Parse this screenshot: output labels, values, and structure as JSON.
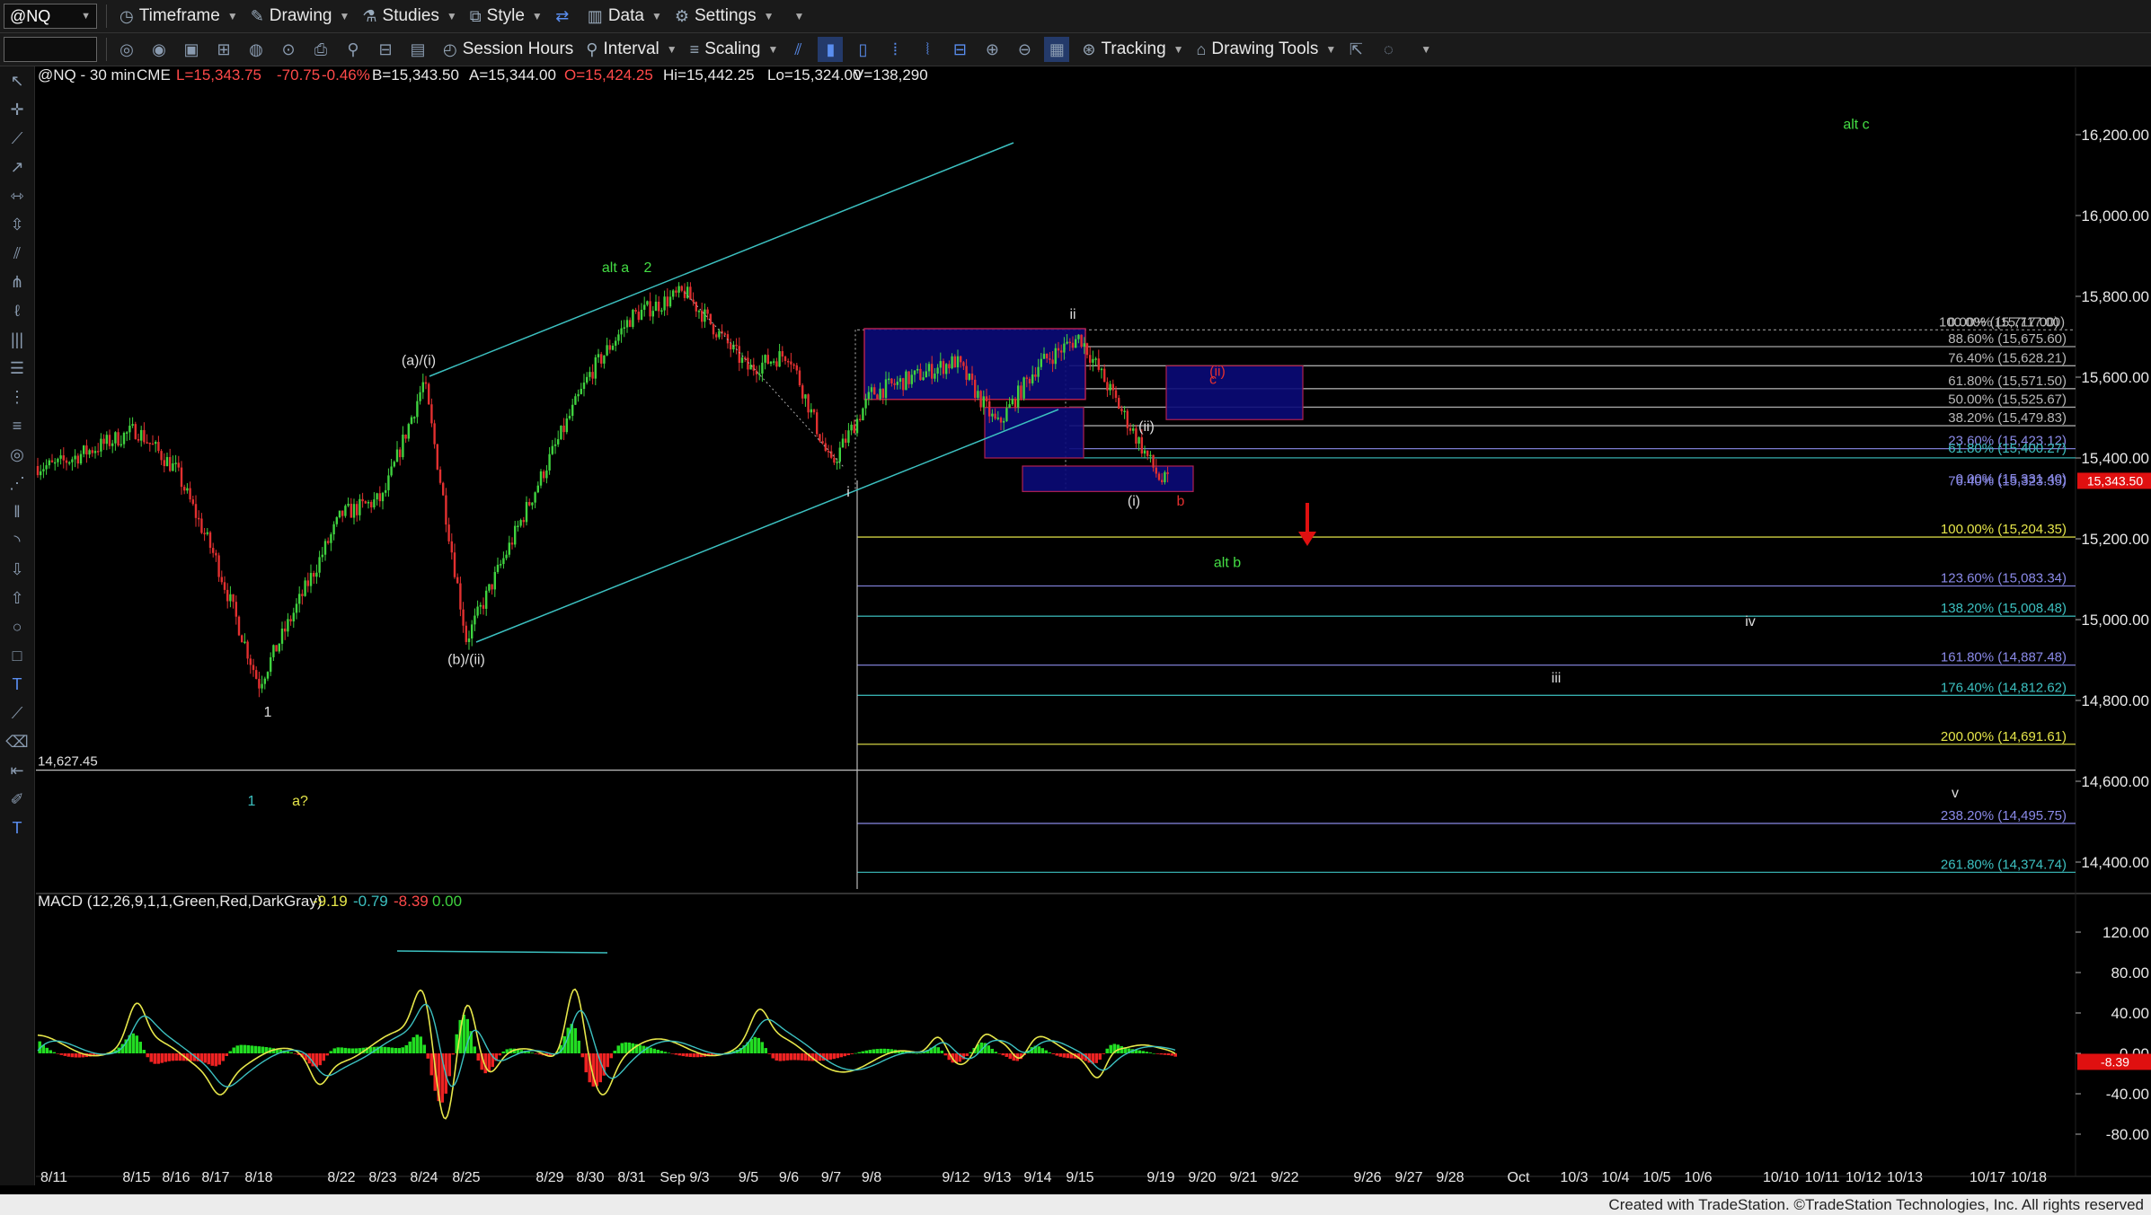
{
  "toolbar": {
    "symbol": "@NQ",
    "timeframe": "Timeframe",
    "drawing": "Drawing",
    "studies": "Studies",
    "style": "Style",
    "data": "Data",
    "settings": "Settings",
    "session_hours": "Session Hours",
    "interval": "Interval",
    "scaling": "Scaling",
    "tracking": "Tracking",
    "drawing_tools": "Drawing Tools"
  },
  "header": {
    "title": "@NQ - 30 min",
    "exchange": "CME",
    "last": "L=15,343.75",
    "change": "-70.75",
    "pct": "-0.46%",
    "bid": "B=15,343.50",
    "ask": "A=15,344.00",
    "open": "O=15,424.25",
    "high": "Hi=15,442.25",
    "low": "Lo=15,324.00",
    "volume": "V=138,290"
  },
  "macd": {
    "label": "MACD (12,26,9,1,1,Green,Red,DarkGray)",
    "v1": "-9.19",
    "v2": "-0.79",
    "v3": "-8.39",
    "v4": "0.00",
    "last_tag": "-8.39"
  },
  "footer": "Created with TradeStation. ©TradeStation Technologies, Inc. All rights reserved",
  "colors": {
    "up": "#3fd23f",
    "down": "#e23030",
    "channel": "#3cc0c0",
    "fib_yellow": "#e6e64a",
    "fib_blue": "#8a8ae8",
    "fib_gray": "#b8b8b8",
    "box_fill": "#0a0a78",
    "box_border": "#b02050",
    "green_label": "#44dd44"
  },
  "chart_data": {
    "type": "candlestick",
    "symbol": "@NQ",
    "interval": "30 min",
    "ylim": [
      14340,
      16300
    ],
    "y_ticks": [
      "16,200.00",
      "16,000.00",
      "15,800.00",
      "15,600.00",
      "15,400.00",
      "15,200.00",
      "15,000.00",
      "14,800.00",
      "14,600.00",
      "14,400.00"
    ],
    "y_tick_values": [
      16200,
      16000,
      15800,
      15600,
      15400,
      15200,
      15000,
      14800,
      14600,
      14400
    ],
    "last_price_tag": "15,343.50",
    "x_ticks": [
      "8/11",
      "8/15",
      "8/16",
      "8/17",
      "8/18",
      "8/22",
      "8/23",
      "8/24",
      "8/25",
      "8/29",
      "8/30",
      "8/31",
      "Sep 9/3",
      "9/5",
      "9/6",
      "9/7",
      "9/8",
      "9/12",
      "9/13",
      "9/14",
      "9/15",
      "9/19",
      "9/20",
      "9/21",
      "9/22",
      "9/26",
      "9/27",
      "9/28",
      "Oct",
      "10/3",
      "10/4",
      "10/5",
      "10/6",
      "10/10",
      "10/11",
      "10/12",
      "10/13",
      "10/17",
      "10/18"
    ],
    "price_path_dates": [
      "8/11",
      "8/15",
      "8/16",
      "8/17",
      "8/18",
      "8/22",
      "8/23",
      "8/24",
      "8/25",
      "8/29",
      "8/30",
      "8/31",
      "Sep 9/3",
      "9/5",
      "9/6",
      "9/7",
      "9/8",
      "9/12",
      "9/13",
      "9/14",
      "9/15",
      "9/19"
    ],
    "price_path_values": [
      15380,
      15470,
      15370,
      15150,
      14840,
      15260,
      15300,
      15590,
      14950,
      15400,
      15610,
      15750,
      15810,
      15620,
      15660,
      15380,
      15560,
      15640,
      15480,
      15630,
      15700,
      15343
    ],
    "fib_levels": [
      {
        "label": "100.00% (15,717.00)",
        "price": 15717.0,
        "color": "#b8b8b8"
      },
      {
        "label": "0.00% (15,717.00)",
        "price": 15717.0,
        "color": "#b8b8b8"
      },
      {
        "label": "88.60% (15,675.60)",
        "price": 15675.6,
        "color": "#b8b8b8"
      },
      {
        "label": "76.40% (15,628.21)",
        "price": 15628.21,
        "color": "#b8b8b8"
      },
      {
        "label": "61.80% (15,571.50)",
        "price": 15571.5,
        "color": "#b8b8b8"
      },
      {
        "label": "50.00% (15,525.67)",
        "price": 15525.67,
        "color": "#b8b8b8"
      },
      {
        "label": "38.20% (15,479.83)",
        "price": 15479.83,
        "color": "#b8b8b8"
      },
      {
        "label": "23.60% (15,423.12)",
        "price": 15423.12,
        "color": "#8a8ae8"
      },
      {
        "label": "61.80% (15,400.27)",
        "price": 15400.27,
        "color": "#3cc0c0"
      },
      {
        "label": "0.00% (15,331.40)",
        "price": 15331.4,
        "color": "#8a8ae8"
      },
      {
        "label": "76.40% (15,323.35)",
        "price": 15323.35,
        "color": "#8a8ae8"
      },
      {
        "label": "100.00% (15,204.35)",
        "price": 15204.35,
        "color": "#e6e64a"
      },
      {
        "label": "123.60% (15,083.34)",
        "price": 15083.34,
        "color": "#8a8ae8"
      },
      {
        "label": "138.20% (15,008.48)",
        "price": 15008.48,
        "color": "#3cc0c0"
      },
      {
        "label": "161.80% (14,887.48)",
        "price": 14887.48,
        "color": "#8a8ae8"
      },
      {
        "label": "176.40% (14,812.62)",
        "price": 14812.62,
        "color": "#3cc0c0"
      },
      {
        "label": "200.00% (14,691.61)",
        "price": 14691.61,
        "color": "#e6e64a"
      },
      {
        "label": "238.20% (14,495.75)",
        "price": 14495.75,
        "color": "#8a8ae8"
      },
      {
        "label": "261.80% (14,374.74)",
        "price": 14374.74,
        "color": "#3cc0c0"
      }
    ],
    "horizontal_line": {
      "label": "14,627.45",
      "price": 14627.45
    },
    "annotations": [
      {
        "text": "alt c",
        "date": "10/11",
        "price": 16215,
        "color": "#44dd44"
      },
      {
        "text": "alt a",
        "date": "8/31",
        "price": 15860,
        "color": "#44dd44"
      },
      {
        "text": "2",
        "date": "8/31",
        "price": 15860,
        "color": "#44dd44"
      },
      {
        "text": "(a)/(i)",
        "date": "8/24",
        "price": 15630,
        "color": "#dddddd"
      },
      {
        "text": "(b)/(ii)",
        "date": "8/25",
        "price": 14890,
        "color": "#dddddd"
      },
      {
        "text": "1",
        "date": "8/18",
        "price": 14760,
        "color": "#dddddd"
      },
      {
        "text": "1",
        "date": "8/17",
        "price": 14540,
        "color": "#3cc0c0"
      },
      {
        "text": "a?",
        "date": "8/18",
        "price": 14540,
        "color": "#e6e64a"
      },
      {
        "text": "ii",
        "date": "9/15",
        "price": 15745,
        "color": "#dddddd"
      },
      {
        "text": "(ii)",
        "date": "9/19",
        "price": 15467,
        "color": "#dddddd"
      },
      {
        "text": "(i)",
        "date": "9/19",
        "price": 15282,
        "color": "#dddddd"
      },
      {
        "text": "(ii)",
        "date": "9/20",
        "price": 15603,
        "color": "#e23030"
      },
      {
        "text": "c",
        "date": "9/20",
        "price": 15583,
        "color": "#e23030"
      },
      {
        "text": "b",
        "date": "9/19",
        "price": 15282,
        "color": "#e23030"
      },
      {
        "text": "i",
        "date": "9/7",
        "price": 15305,
        "color": "#dddddd"
      },
      {
        "text": "alt b",
        "date": "9/21",
        "price": 15130,
        "color": "#44dd44"
      },
      {
        "text": "iv",
        "date": "10/6",
        "price": 14985,
        "color": "#dddddd"
      },
      {
        "text": "iii",
        "date": "10/3",
        "price": 14845,
        "color": "#dddddd"
      },
      {
        "text": "v",
        "date": "10/13",
        "price": 14560,
        "color": "#dddddd"
      }
    ],
    "macd_ylim": [
      -110,
      140
    ],
    "macd_ticks": [
      "120.00",
      "80.00",
      "40.00",
      "0.00",
      "-40.00",
      "-80.00"
    ],
    "macd_tick_values": [
      120,
      80,
      40,
      0,
      -40,
      -80
    ]
  }
}
